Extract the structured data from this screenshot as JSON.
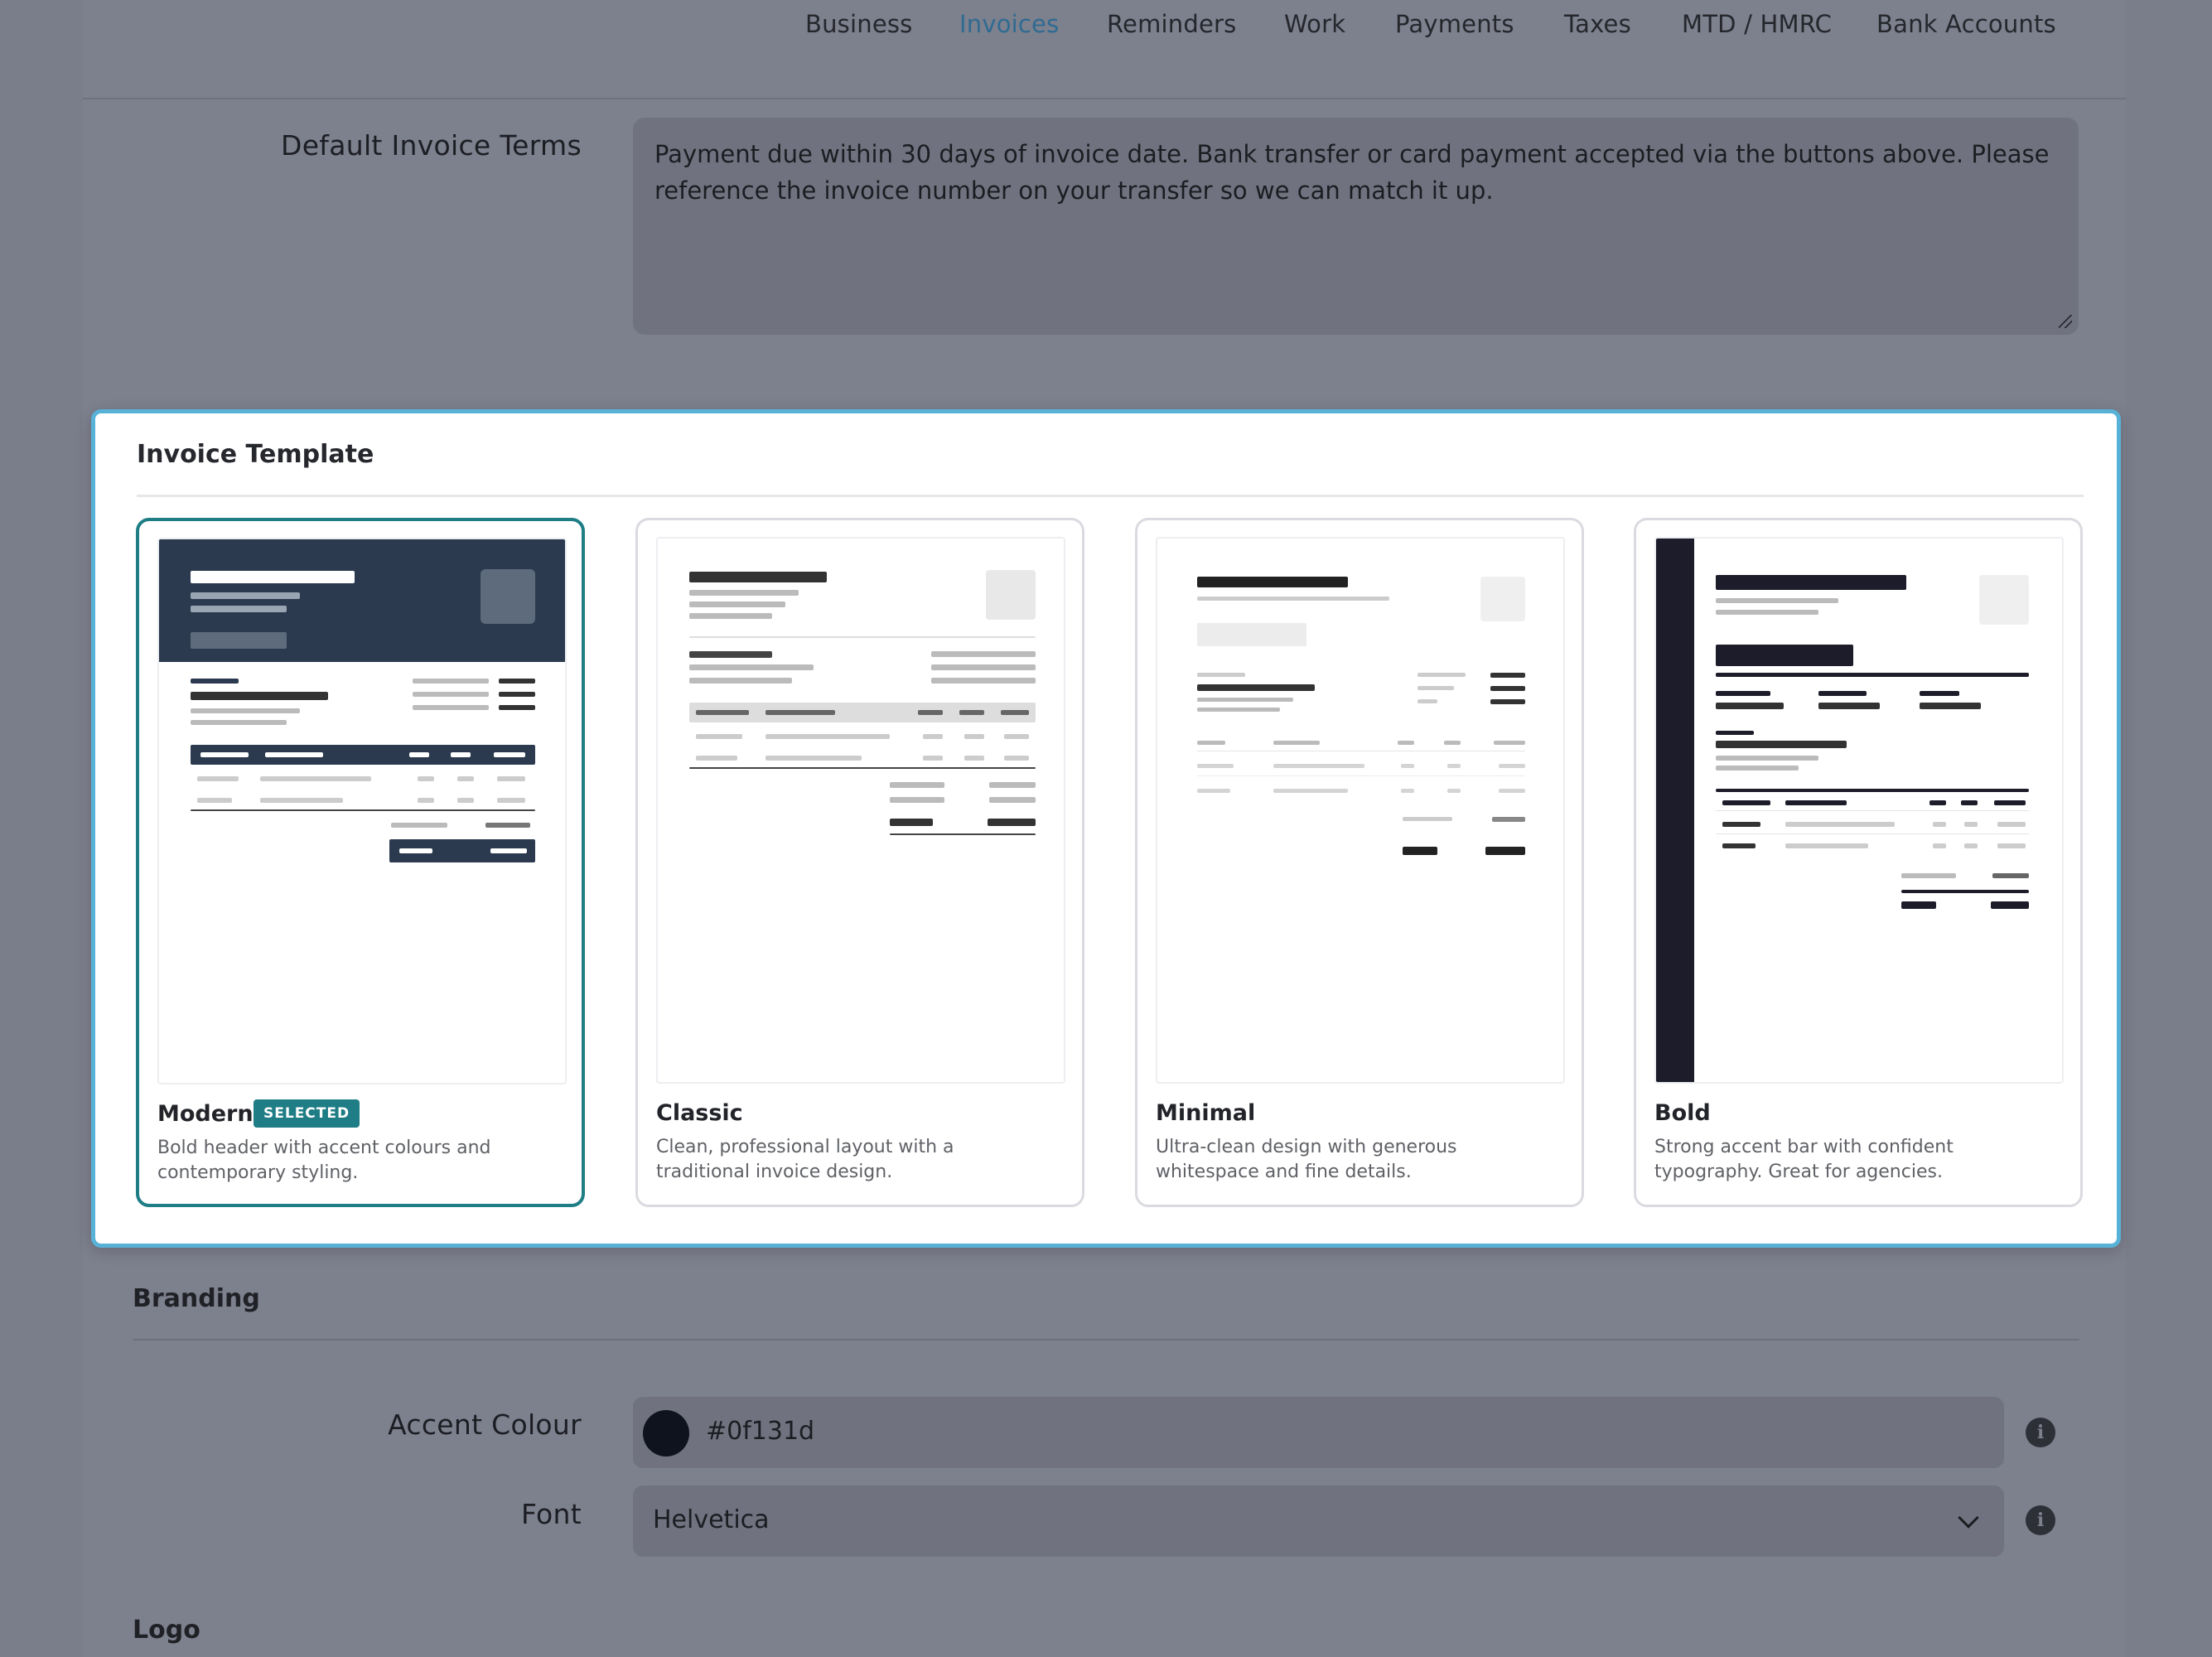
{
  "nav": {
    "tabs": [
      "Business",
      "Invoices",
      "Reminders",
      "Work",
      "Payments",
      "Taxes",
      "MTD / HMRC",
      "Bank Accounts"
    ],
    "active": "Invoices"
  },
  "terms": {
    "label": "Default Invoice Terms",
    "value": "Payment due within 30 days of invoice date. Bank transfer or card payment accepted via the buttons above. Please reference the invoice number on your transfer so we can match it up."
  },
  "template_section": {
    "title": "Invoice Template",
    "selected_badge": "SELECTED",
    "templates": [
      {
        "name": "Modern",
        "description": "Bold header with accent colours and contemporary styling.",
        "selected": true
      },
      {
        "name": "Classic",
        "description": "Clean, professional layout with a traditional invoice design.",
        "selected": false
      },
      {
        "name": "Minimal",
        "description": "Ultra-clean design with generous whitespace and fine details.",
        "selected": false
      },
      {
        "name": "Bold",
        "description": "Strong accent bar with confident typography. Great for agencies.",
        "selected": false
      }
    ]
  },
  "branding": {
    "title": "Branding",
    "accent_label": "Accent Colour",
    "accent_value": "#0f131d",
    "font_label": "Font",
    "font_value": "Helvetica",
    "info_icon": "info-icon"
  },
  "logo": {
    "title": "Logo"
  },
  "colors": {
    "accent_teal": "#1f7d86",
    "highlight_border": "#58b2d8",
    "active_tab": "#2f6b92"
  }
}
